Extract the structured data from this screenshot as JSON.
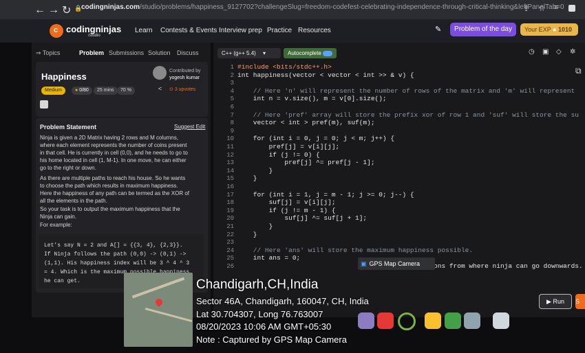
{
  "browser": {
    "url_domain": "codingninjas.com",
    "url_rest": "/studio/problems/happiness_9127702?challengeSlug=freedom-codefest-celebrating-independence-through-critical-thinking&leftPanelTab=0"
  },
  "header": {
    "logo": "codingninjas",
    "logo_sub": "/studio",
    "nav": [
      "Learn",
      "Contests & Events",
      "Interview prep",
      "Practice",
      "Resources"
    ],
    "potd": "Problem of the day",
    "exp_label": "Your EXP",
    "exp_value": "1010"
  },
  "left": {
    "tabs": [
      "Topics",
      "Problem",
      "Submissions",
      "Solution",
      "Discuss"
    ],
    "title": "Happiness",
    "contrib_label": "Contributed by",
    "contrib_name": "yogesh kumar",
    "difficulty": "Medium",
    "score": "0/80",
    "time": "25 mins",
    "success": "70 %",
    "upvotes": "3 upvotes",
    "statement_title": "Problem Statement",
    "suggest": "Suggest Edit",
    "desc": [
      "Ninja is given a 2D Matrix having 2 rows and M columns,",
      "where each element represents the number of coins present",
      "in that cell. He is currently in cell (0,0), and he needs to go to",
      "his home located in cell (1, M-1). In one move, he can either",
      "go to the right or down.",
      "As there are multiple paths to reach his house. So he wants",
      "to choose the path which results in maximum happiness.",
      "Here the happiness of any path can be termed as the XOR of",
      "all the elements in the path.",
      "So your task is to output the maximum happiness that the",
      "Ninja can gain.",
      "For example:"
    ],
    "example": [
      "Let's say N = 2 and A[] = {{3, 4}, {2,3}}.",
      "If Ninja follows the path (0,0) -> (0,1) ->",
      "(1,1). His happiness index will be 3 ^ 4 ^ 3",
      "= 4. Which is the maximum possible happiness",
      "he can get."
    ]
  },
  "editor": {
    "language": "C++ (g++ 5.4)",
    "autocomplete": "Autocomplete",
    "line_numbers": [
      "1",
      "2",
      "3",
      "4",
      "5",
      "6",
      "7",
      "8",
      "9",
      "10",
      "11",
      "12",
      "13",
      "14",
      "15",
      "16",
      "17",
      "18",
      "19",
      "20",
      "21",
      "22",
      "23",
      "24",
      "25",
      "26"
    ],
    "lines": [
      "#include <bits/stdc++.h>",
      "int happiness(vector < vector < int >> & v) {",
      "",
      "    // Here 'n' will represent the number of rows of the matrix and 'm' will represent",
      "    int n = v.size(), m = v[0].size();",
      "",
      "    // Here 'pref' array will store the prefix xor of row 1 and 'suf' will store the su",
      "    vector < int > pref(m), suf(m);",
      "",
      "    for (int i = 0, j = 0; j < m; j++) {",
      "        pref[j] = v[i][j];",
      "        if (j != 0) {",
      "            pref[j] ^= pref[j - 1];",
      "        }",
      "    }",
      "",
      "    for (int i = 1, j = m - 1; j >= 0; j--) {",
      "        suf[j] = v[i][j];",
      "        if (j != m - 1) {",
      "            suf[j] ^= suf[j + 1];",
      "        }",
      "    }",
      "",
      "    // Here 'ans' will store the maximum happiness possible.",
      "    int ans = 0;",
      "                                 the possible options from where ninja can go downwards."
    ],
    "run": "Run",
    "submit": "S"
  },
  "overlay": {
    "gps_label": "GPS Map Camera",
    "city": "Chandigarh,CH,India",
    "address": "Sector 46A, Chandigarh, 160047, CH, India",
    "latlong": "Lat 30.704307, Long 76.763007",
    "datetime": "08/20/2023 10:06 AM GMT+05:30",
    "note": "Note : Captured by GPS Map Camera"
  }
}
